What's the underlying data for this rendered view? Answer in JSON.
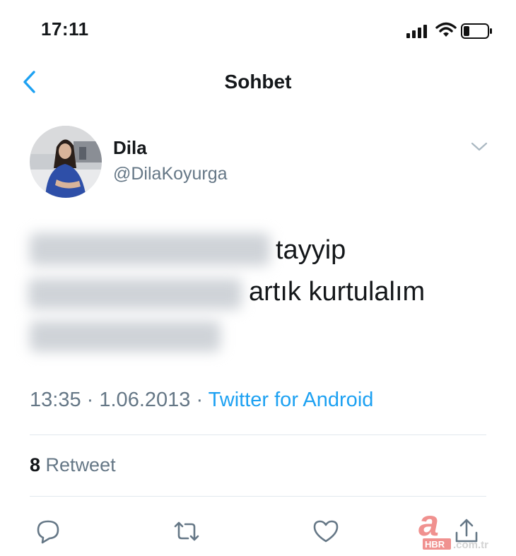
{
  "status_bar": {
    "time": "17:11"
  },
  "nav": {
    "title": "Sohbet"
  },
  "tweet": {
    "name": "Dila",
    "handle": "@DilaKoyurga",
    "lines": [
      "tayyip",
      "artık kurtulalım"
    ],
    "time": "13:35",
    "date": "1.06.2013",
    "separator": "·",
    "source": "Twitter for Android",
    "retweet_count": "8",
    "retweet_label": "Retweet"
  },
  "actions": [
    "reply-icon",
    "retweet-icon",
    "like-icon",
    "share-icon"
  ],
  "watermark": "a HBR.com.tr",
  "colors": {
    "link": "#1da1f2",
    "muted": "#657786",
    "divider": "#e1e8ed"
  }
}
